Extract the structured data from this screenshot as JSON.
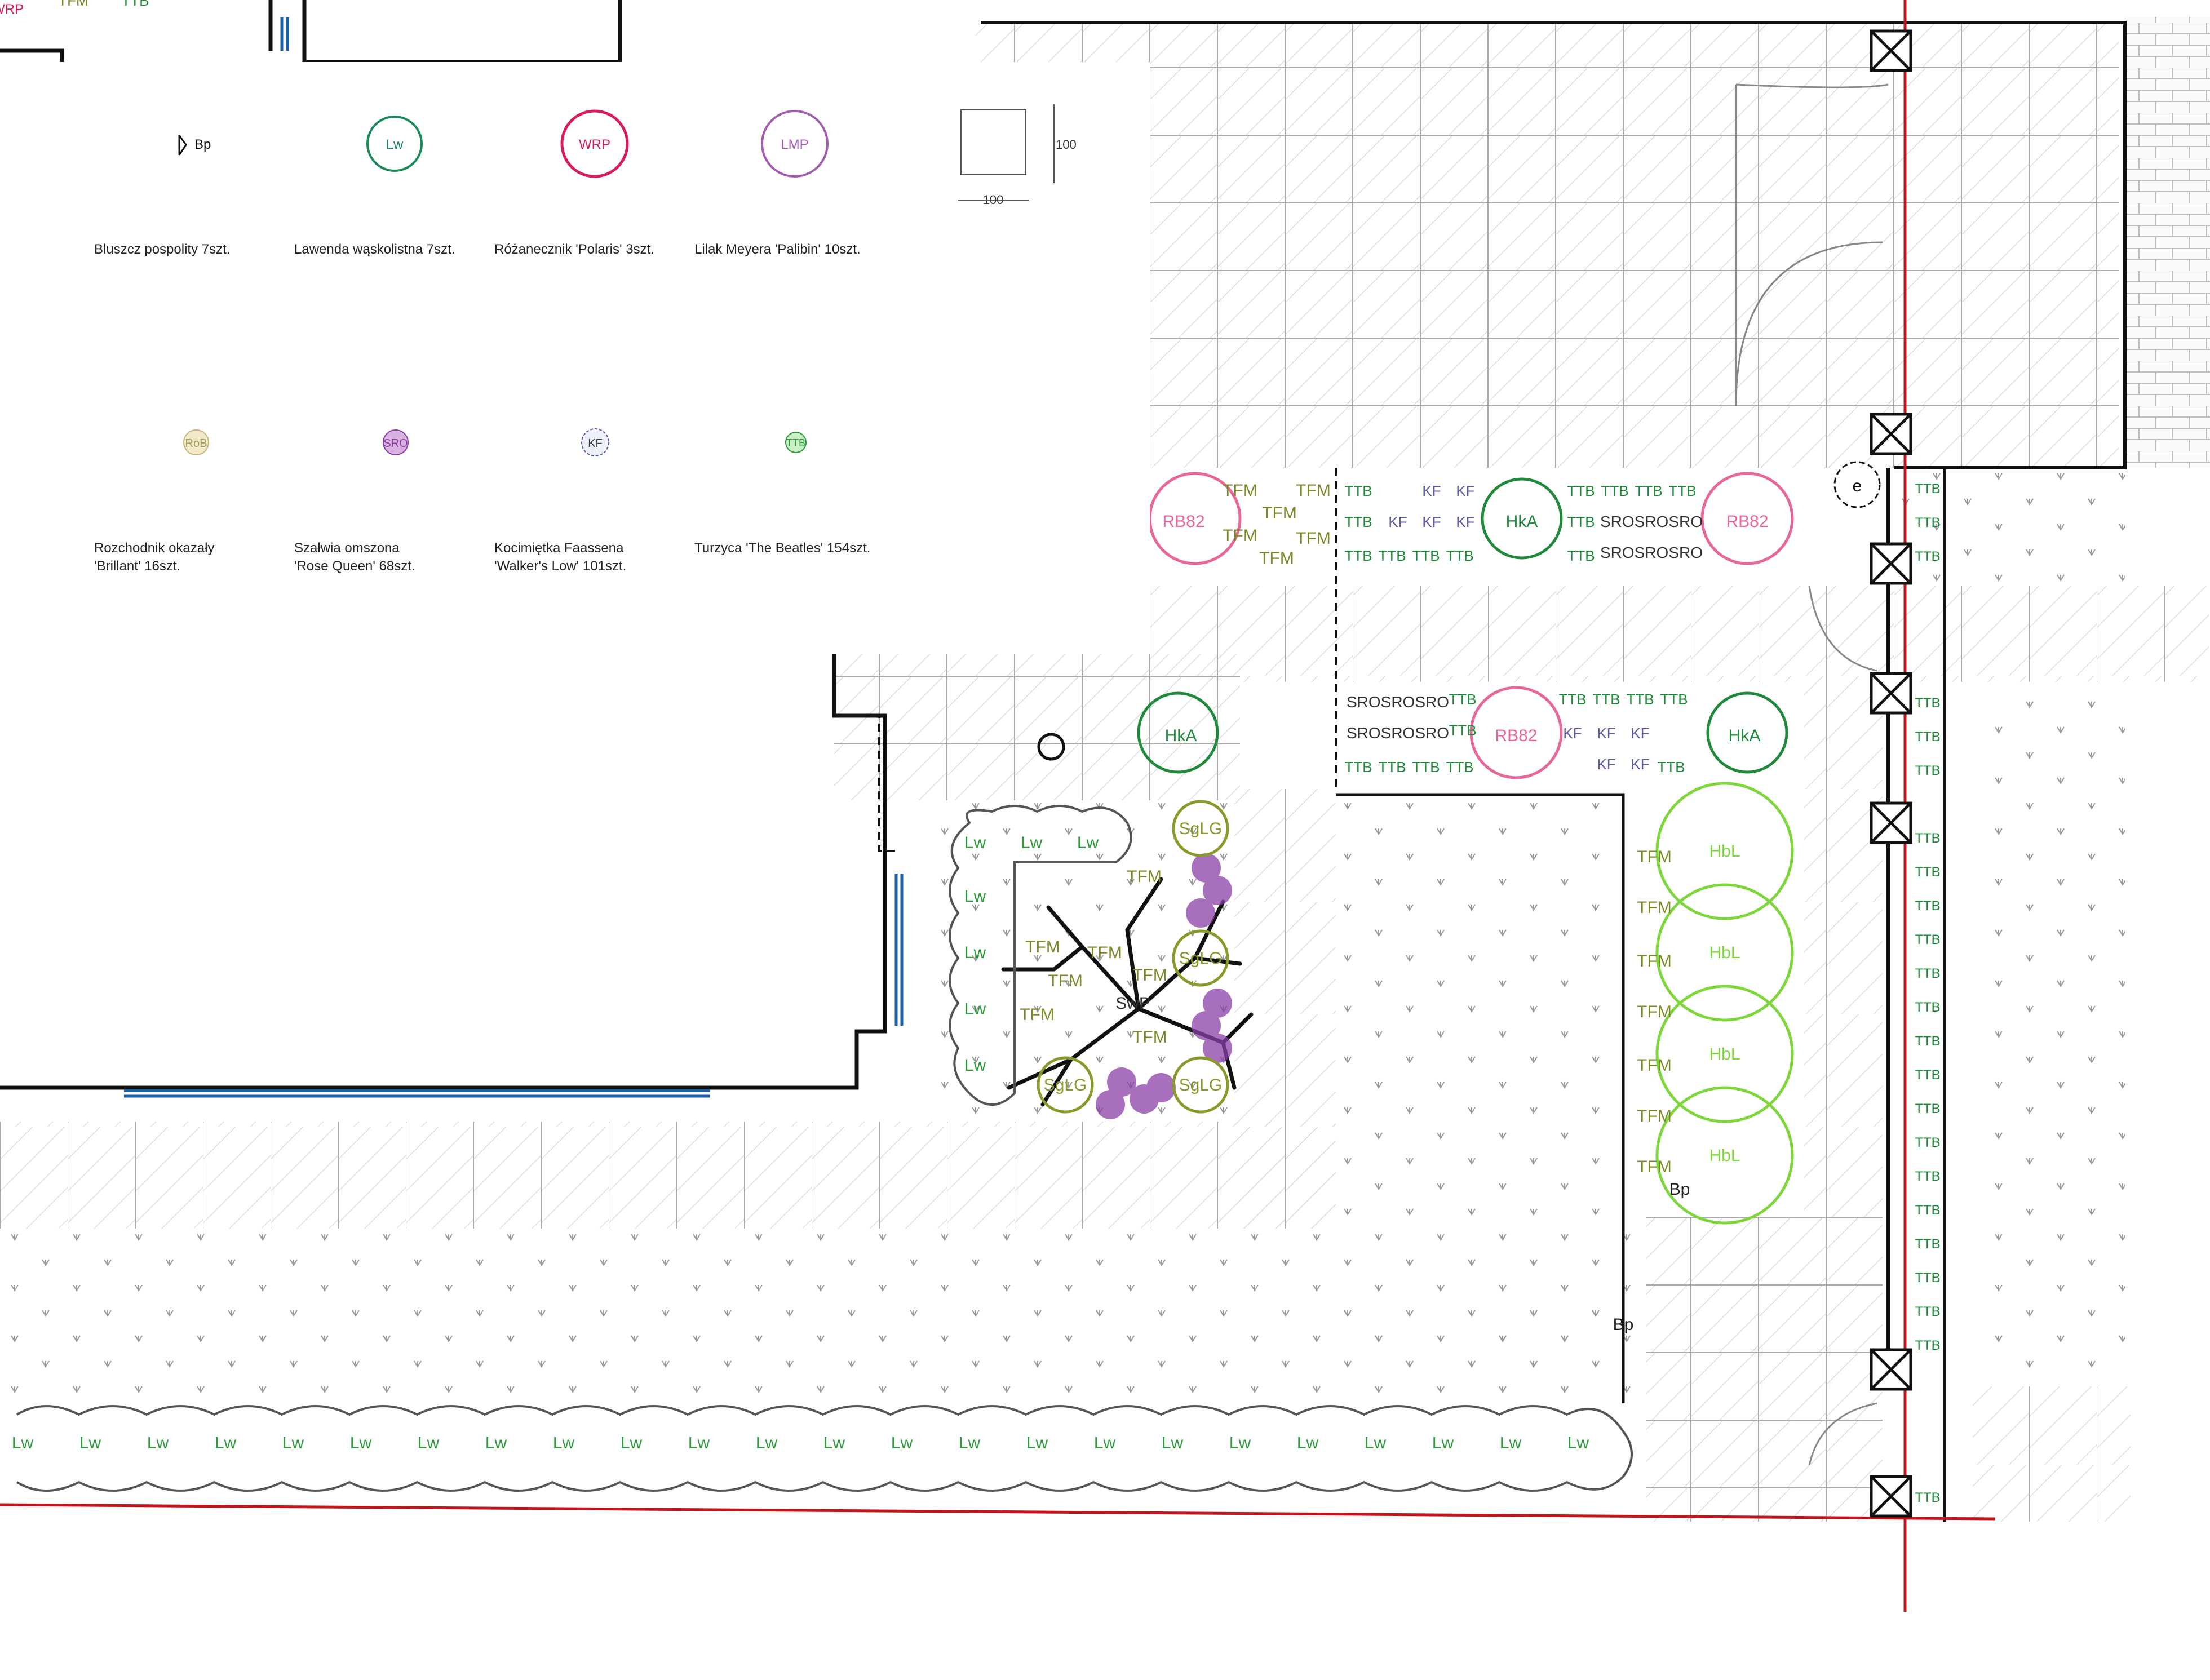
{
  "legend": {
    "row1": [
      {
        "code": "Bp",
        "name": "Bluszcz pospolity 7szt.",
        "color": "#1f1f1f"
      },
      {
        "code": "Lw",
        "name": "Lawenda wąskolistna 7szt.",
        "color": "#1a8a5a"
      },
      {
        "code": "WRP",
        "name": "Różanecznik 'Polaris' 3szt.",
        "color": "#d81b60"
      },
      {
        "code": "LMP",
        "name": "Lilak Meyera 'Palibin' 10szt.",
        "color": "#a35cb0"
      }
    ],
    "scale": {
      "width_label": "100",
      "height_label": "100"
    },
    "row2": [
      {
        "code": "RoB",
        "line1": "Rozchodnik okazały",
        "line2": "'Brillant' 16szt.",
        "color": "#9a9a55"
      },
      {
        "code": "SRO",
        "line1": "Szałwia omszona",
        "line2": "'Rose Queen' 68szt.",
        "color": "#8e3fa6"
      },
      {
        "code": "KF",
        "line1": "Kocimiętka Faassena",
        "line2": "'Walker's Low' 101szt.",
        "color": "#5a5aa8"
      },
      {
        "code": "TTB",
        "line1": "Turzyca 'The Beatles' 154szt.",
        "line2": "",
        "color": "#2a9d3a"
      }
    ]
  },
  "plan_labels": {
    "rb82": "RB82",
    "hka": "HkA",
    "hbl": "HbL",
    "sglg": "SgLG",
    "swp": "SwP",
    "lw": "Lw",
    "tfm": "TFM",
    "ttb": "TTB",
    "kf": "KF",
    "sro": "SRO",
    "sro_row": "SROSROSRO",
    "bp": "Bp",
    "e": "e",
    "tfm_top": "TFM",
    "wrp_top": "WRP",
    "ttb_top": "TTB"
  },
  "colors": {
    "wall": "#111111",
    "property_line": "#c0151b",
    "rose": "#e8679a",
    "green_dark": "#1f8a3a",
    "green_light": "#7dd63a",
    "olive": "#8a9a2a",
    "purple": "#8b3fa8",
    "blue": "#1b5fa8",
    "grey_line": "#9a9a9a"
  }
}
